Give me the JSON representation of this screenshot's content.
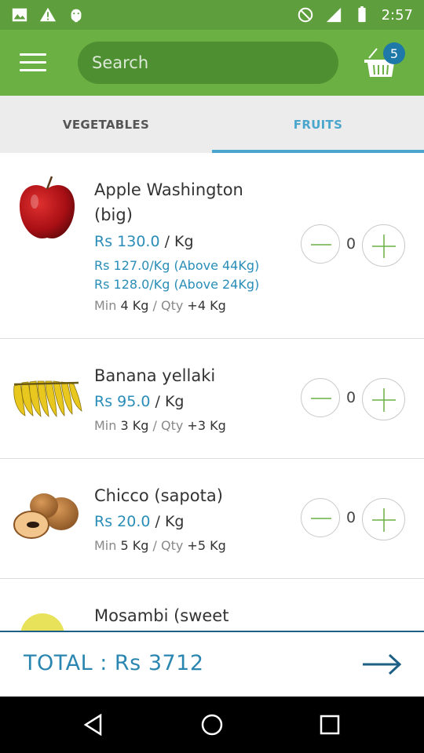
{
  "status_bar": {
    "time": "2:57"
  },
  "search": {
    "placeholder": "Search"
  },
  "cart": {
    "count": "5"
  },
  "tabs": [
    {
      "label": "VEGETABLES",
      "active": false
    },
    {
      "label": "FRUITS",
      "active": true
    }
  ],
  "products": [
    {
      "name": "Apple Washington (big)",
      "price": "Rs 130.0",
      "unit": "/ Kg",
      "tiers": [
        "Rs 127.0/Kg (Above 44Kg)",
        "Rs 128.0/Kg (Above 24Kg)"
      ],
      "min_label": "Min",
      "min_value": "4 Kg",
      "qty_label": "/ Qty",
      "qty_value": "+4 Kg",
      "quantity": "0"
    },
    {
      "name": "Banana yellaki",
      "price": "Rs 95.0",
      "unit": "/ Kg",
      "min_label": "Min",
      "min_value": "3 Kg",
      "qty_label": "/ Qty",
      "qty_value": "+3 Kg",
      "quantity": "0"
    },
    {
      "name": "Chicco (sapota)",
      "price": "Rs 20.0",
      "unit": "/ Kg",
      "min_label": "Min",
      "min_value": "5 Kg",
      "qty_label": "/ Qty",
      "qty_value": "+5 Kg",
      "quantity": "0"
    },
    {
      "name": "Mosambi (sweet"
    }
  ],
  "total": {
    "label": "TOTAL : Rs 3712"
  },
  "colors": {
    "brand_green": "#6ab043",
    "accent_blue": "#2a8db8"
  }
}
